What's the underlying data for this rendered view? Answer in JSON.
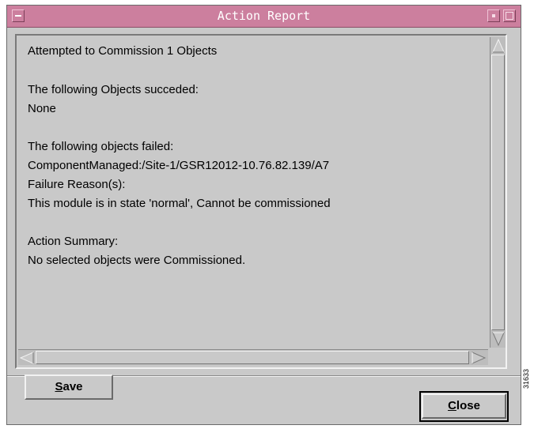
{
  "window": {
    "title": "Action Report"
  },
  "report": {
    "lines": [
      "Attempted to Commission 1 Objects",
      "The following Objects succeded:",
      "None",
      "The following objects failed:",
      "ComponentManaged:/Site-1/GSR12012-10.76.82.139/A7",
      "Failure Reason(s):",
      "This module is in  state 'normal', Cannot be commissioned",
      "Action Summary:",
      "No selected objects were Commissioned."
    ]
  },
  "buttons": {
    "save_label": "Save",
    "close_label": "Close"
  },
  "figure_number": "31633",
  "colors": {
    "titlebar": "#cc7f9e",
    "window_bg": "#c9c9c9"
  }
}
